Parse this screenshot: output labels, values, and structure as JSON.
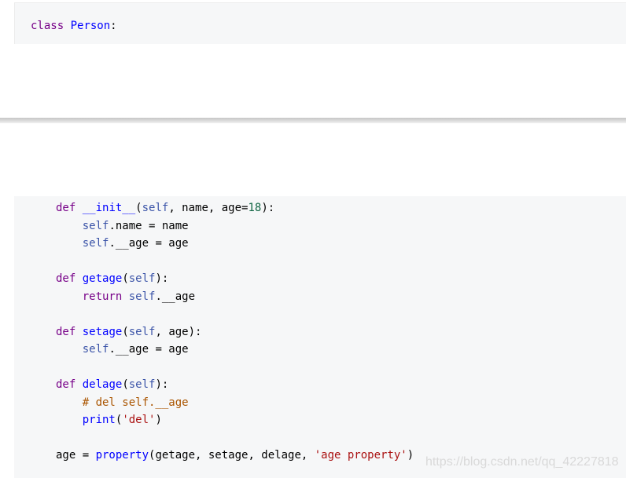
{
  "code_block_top": {
    "line1": {
      "keyword": "class",
      "name": "Person",
      "colon": ":"
    }
  },
  "code_block_bottom": {
    "l1": {
      "indent": "    ",
      "kw": "def",
      "fn": "__init__",
      "open": "(",
      "self": "self",
      "args": ", name, age=",
      "num": "18",
      "close": "):"
    },
    "l2": {
      "indent": "        ",
      "self": "self",
      "rest": ".name = name"
    },
    "l3": {
      "indent": "        ",
      "self": "self",
      "rest": ".__age = age"
    },
    "l4": {
      "text": ""
    },
    "l5": {
      "indent": "    ",
      "kw": "def",
      "fn": "getage",
      "open": "(",
      "self": "self",
      "close": "):"
    },
    "l6": {
      "indent": "        ",
      "kw": "return",
      "self": "self",
      "rest": ".__age"
    },
    "l7": {
      "text": ""
    },
    "l8": {
      "indent": "    ",
      "kw": "def",
      "fn": "setage",
      "open": "(",
      "self": "self",
      "args": ", age",
      "close": "):"
    },
    "l9": {
      "indent": "        ",
      "self": "self",
      "rest": ".__age = age"
    },
    "l10": {
      "text": ""
    },
    "l11": {
      "indent": "    ",
      "kw": "def",
      "fn": "delage",
      "open": "(",
      "self": "self",
      "close": "):"
    },
    "l12": {
      "indent": "        ",
      "comment": "# del self.__age"
    },
    "l13": {
      "indent": "        ",
      "builtin": "print",
      "open": "(",
      "str": "'del'",
      "close": ")"
    },
    "l14": {
      "text": ""
    },
    "l15": {
      "indent": "    ",
      "lhs": "age = ",
      "builtin": "property",
      "args": "(getage, setage, delage, ",
      "str": "'age property'",
      "close": ")"
    }
  },
  "watermark": "https://blog.csdn.net/qq_42227818",
  "colors": {
    "keyword": "#770088",
    "function": "#0000ff",
    "self": "#3b54a8",
    "number": "#116644",
    "string": "#aa1111",
    "comment": "#aa5500",
    "code_bg": "#f6f7f8"
  }
}
